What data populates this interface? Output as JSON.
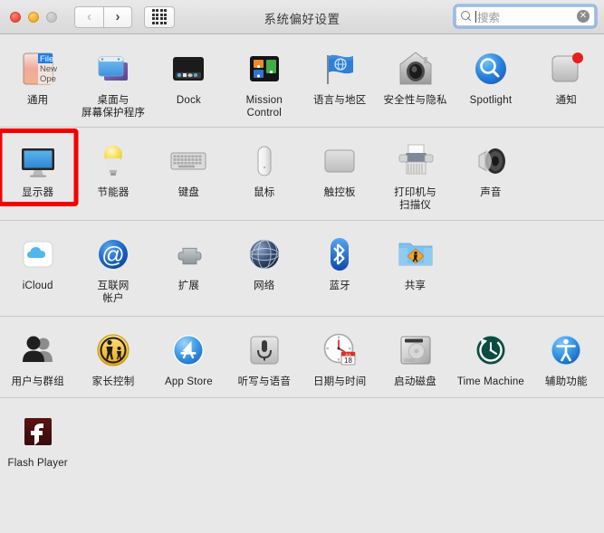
{
  "window": {
    "title": "系统偏好设置",
    "traffic_lights": [
      "close",
      "minimize",
      "zoom"
    ],
    "nav": {
      "back_label": "‹",
      "forward_label": "›",
      "grid_label": "show-all"
    },
    "search": {
      "placeholder": "搜索",
      "value": "",
      "clear_label": "✕"
    }
  },
  "highlight": {
    "target": "显示器",
    "color": "#f50000"
  },
  "groups": [
    {
      "name": "personal",
      "items": [
        {
          "label": "通用",
          "icon": "general-icon"
        },
        {
          "label": "桌面与\n屏幕保护程序",
          "icon": "desktop-screensaver-icon"
        },
        {
          "label": "Dock",
          "icon": "dock-icon"
        },
        {
          "label": "Mission\nControl",
          "icon": "mission-control-icon"
        },
        {
          "label": "语言与地区",
          "icon": "language-region-icon"
        },
        {
          "label": "安全性与隐私",
          "icon": "security-privacy-icon"
        },
        {
          "label": "Spotlight",
          "icon": "spotlight-icon"
        },
        {
          "label": "通知",
          "icon": "notifications-icon"
        }
      ]
    },
    {
      "name": "hardware",
      "items": [
        {
          "label": "显示器",
          "icon": "displays-icon",
          "highlighted": true
        },
        {
          "label": "节能器",
          "icon": "energy-saver-icon"
        },
        {
          "label": "键盘",
          "icon": "keyboard-icon"
        },
        {
          "label": "鼠标",
          "icon": "mouse-icon"
        },
        {
          "label": "触控板",
          "icon": "trackpad-icon"
        },
        {
          "label": "打印机与\n扫描仪",
          "icon": "printers-scanners-icon"
        },
        {
          "label": "声音",
          "icon": "sound-icon"
        }
      ]
    },
    {
      "name": "internet-wireless",
      "items": [
        {
          "label": "iCloud",
          "icon": "icloud-icon"
        },
        {
          "label": "互联网\n帐户",
          "icon": "internet-accounts-icon"
        },
        {
          "label": "扩展",
          "icon": "extensions-icon"
        },
        {
          "label": "网络",
          "icon": "network-icon"
        },
        {
          "label": "蓝牙",
          "icon": "bluetooth-icon"
        },
        {
          "label": "共享",
          "icon": "sharing-icon"
        }
      ]
    },
    {
      "name": "system",
      "items": [
        {
          "label": "用户与群组",
          "icon": "users-groups-icon"
        },
        {
          "label": "家长控制",
          "icon": "parental-controls-icon"
        },
        {
          "label": "App Store",
          "icon": "app-store-icon"
        },
        {
          "label": "听写与语音",
          "icon": "dictation-speech-icon"
        },
        {
          "label": "日期与时间",
          "icon": "date-time-icon"
        },
        {
          "label": "启动磁盘",
          "icon": "startup-disk-icon"
        },
        {
          "label": "Time Machine",
          "icon": "time-machine-icon"
        },
        {
          "label": "辅助功能",
          "icon": "accessibility-icon"
        }
      ]
    },
    {
      "name": "other",
      "items": [
        {
          "label": "Flash Player",
          "icon": "flash-player-icon"
        }
      ]
    }
  ]
}
